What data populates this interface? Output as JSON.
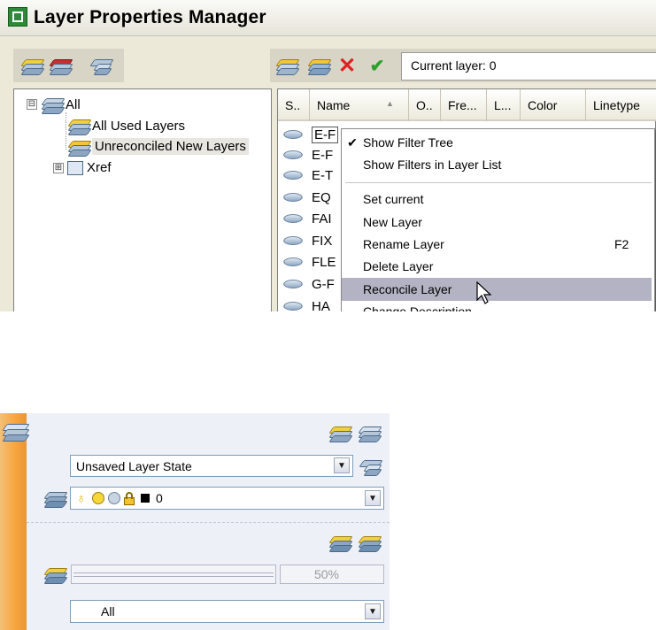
{
  "window": {
    "title": "Layer Properties Manager",
    "current_layer_label": "Current layer: 0"
  },
  "filter_tree": {
    "root": "All",
    "children": [
      "All Used Layers",
      "Unreconciled New Layers"
    ],
    "xref": "Xref",
    "expander_minus": "⊟",
    "expander_plus": "⊞"
  },
  "layer_list": {
    "columns": [
      "S..",
      "Name",
      "O..",
      "Fre...",
      "L...",
      "Color",
      "Linetype"
    ],
    "sort_indicator": "▲",
    "rows": [
      "E-F",
      "E-F",
      "E-T",
      "EQ",
      "FAI",
      "FIX",
      "FLE",
      "G-F",
      "HA"
    ]
  },
  "context_menu": {
    "items": [
      {
        "label": "Show Filter Tree",
        "checked": "✔",
        "shortcut": ""
      },
      {
        "label": "Show Filters in Layer List",
        "checked": "",
        "shortcut": ""
      },
      {
        "label": "Set current",
        "checked": "",
        "shortcut": ""
      },
      {
        "label": "New Layer",
        "checked": "",
        "shortcut": ""
      },
      {
        "label": "Rename Layer",
        "checked": "",
        "shortcut": "F2"
      },
      {
        "label": "Delete Layer",
        "checked": "",
        "shortcut": ""
      },
      {
        "label": "Reconcile Layer",
        "checked": "",
        "shortcut": ""
      },
      {
        "label": "Change Description",
        "checked": "",
        "shortcut": ""
      }
    ],
    "highlighted": "Reconcile Layer"
  },
  "layers_panel": {
    "layer_state": "Unsaved Layer State",
    "current_layer_value": "0",
    "progress_fraction": 0.5,
    "progress_text": "50%",
    "filter_value": "All"
  },
  "colors": {
    "highlight": "#b4b3c3",
    "panel_strip": "#f8a63f",
    "delete_red": "#e02020",
    "check_green": "#2ea02e"
  }
}
